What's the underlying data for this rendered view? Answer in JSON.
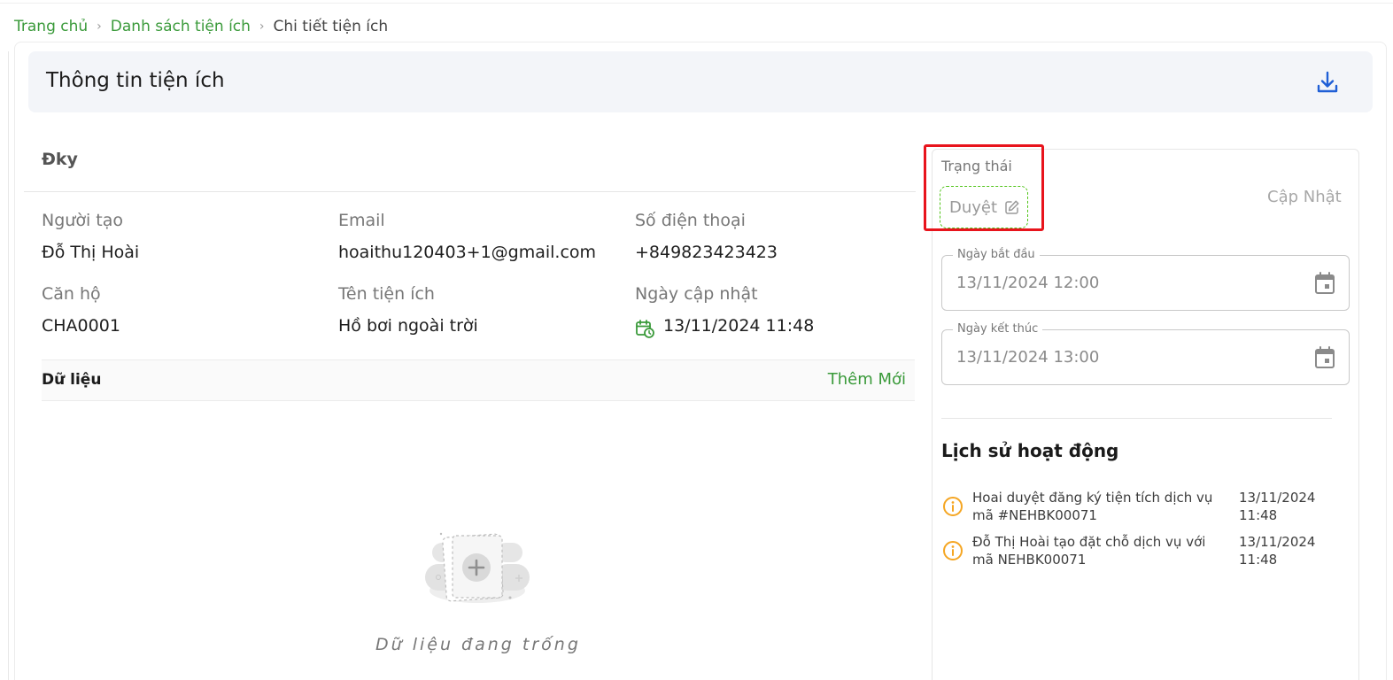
{
  "breadcrumb": {
    "home": "Trang chủ",
    "list": "Danh sách tiện ích",
    "current": "Chi tiết tiện ích",
    "separator": "›"
  },
  "header": {
    "title": "Thông tin tiện ích",
    "download_icon": "download-icon"
  },
  "section": {
    "title": "Đky"
  },
  "fields": {
    "creator_label": "Người tạo",
    "creator_value": "Đỗ Thị Hoài",
    "email_label": "Email",
    "email_value": "hoaithu120403+1@gmail.com",
    "phone_label": "Số điện thoại",
    "phone_value": "+849823423423",
    "apartment_label": "Căn hộ",
    "apartment_value": "CHA0001",
    "utility_label": "Tên tiện ích",
    "utility_value": "Hồ bơi ngoài trời",
    "updated_label": "Ngày cập nhật",
    "updated_value": "13/11/2024 11:48"
  },
  "data_section": {
    "title": "Dữ liệu",
    "add_label": "Thêm Mới",
    "empty_text": "Dữ liệu đang trống"
  },
  "status": {
    "label": "Trạng thái",
    "value": "Duyệt",
    "update_label": "Cập Nhật"
  },
  "dates": {
    "start_label": "Ngày bắt đầu",
    "start_value": "13/11/2024 12:00",
    "end_label": "Ngày kết thúc",
    "end_value": "13/11/2024 13:00"
  },
  "history": {
    "title": "Lịch sử hoạt động",
    "items": [
      {
        "text": "Hoai duyệt đăng ký tiện tích dịch vụ mã #NEHBK00071",
        "time": "13/11/2024 11:48"
      },
      {
        "text": "Đỗ Thị Hoài tạo đặt chỗ dịch vụ với mã NEHBK00071",
        "time": "13/11/2024 11:48"
      }
    ]
  },
  "colors": {
    "accent_green": "#3a9a3a",
    "download_blue": "#1f5fd6",
    "history_orange": "#f5a623",
    "highlight_red": "#e8141c"
  }
}
